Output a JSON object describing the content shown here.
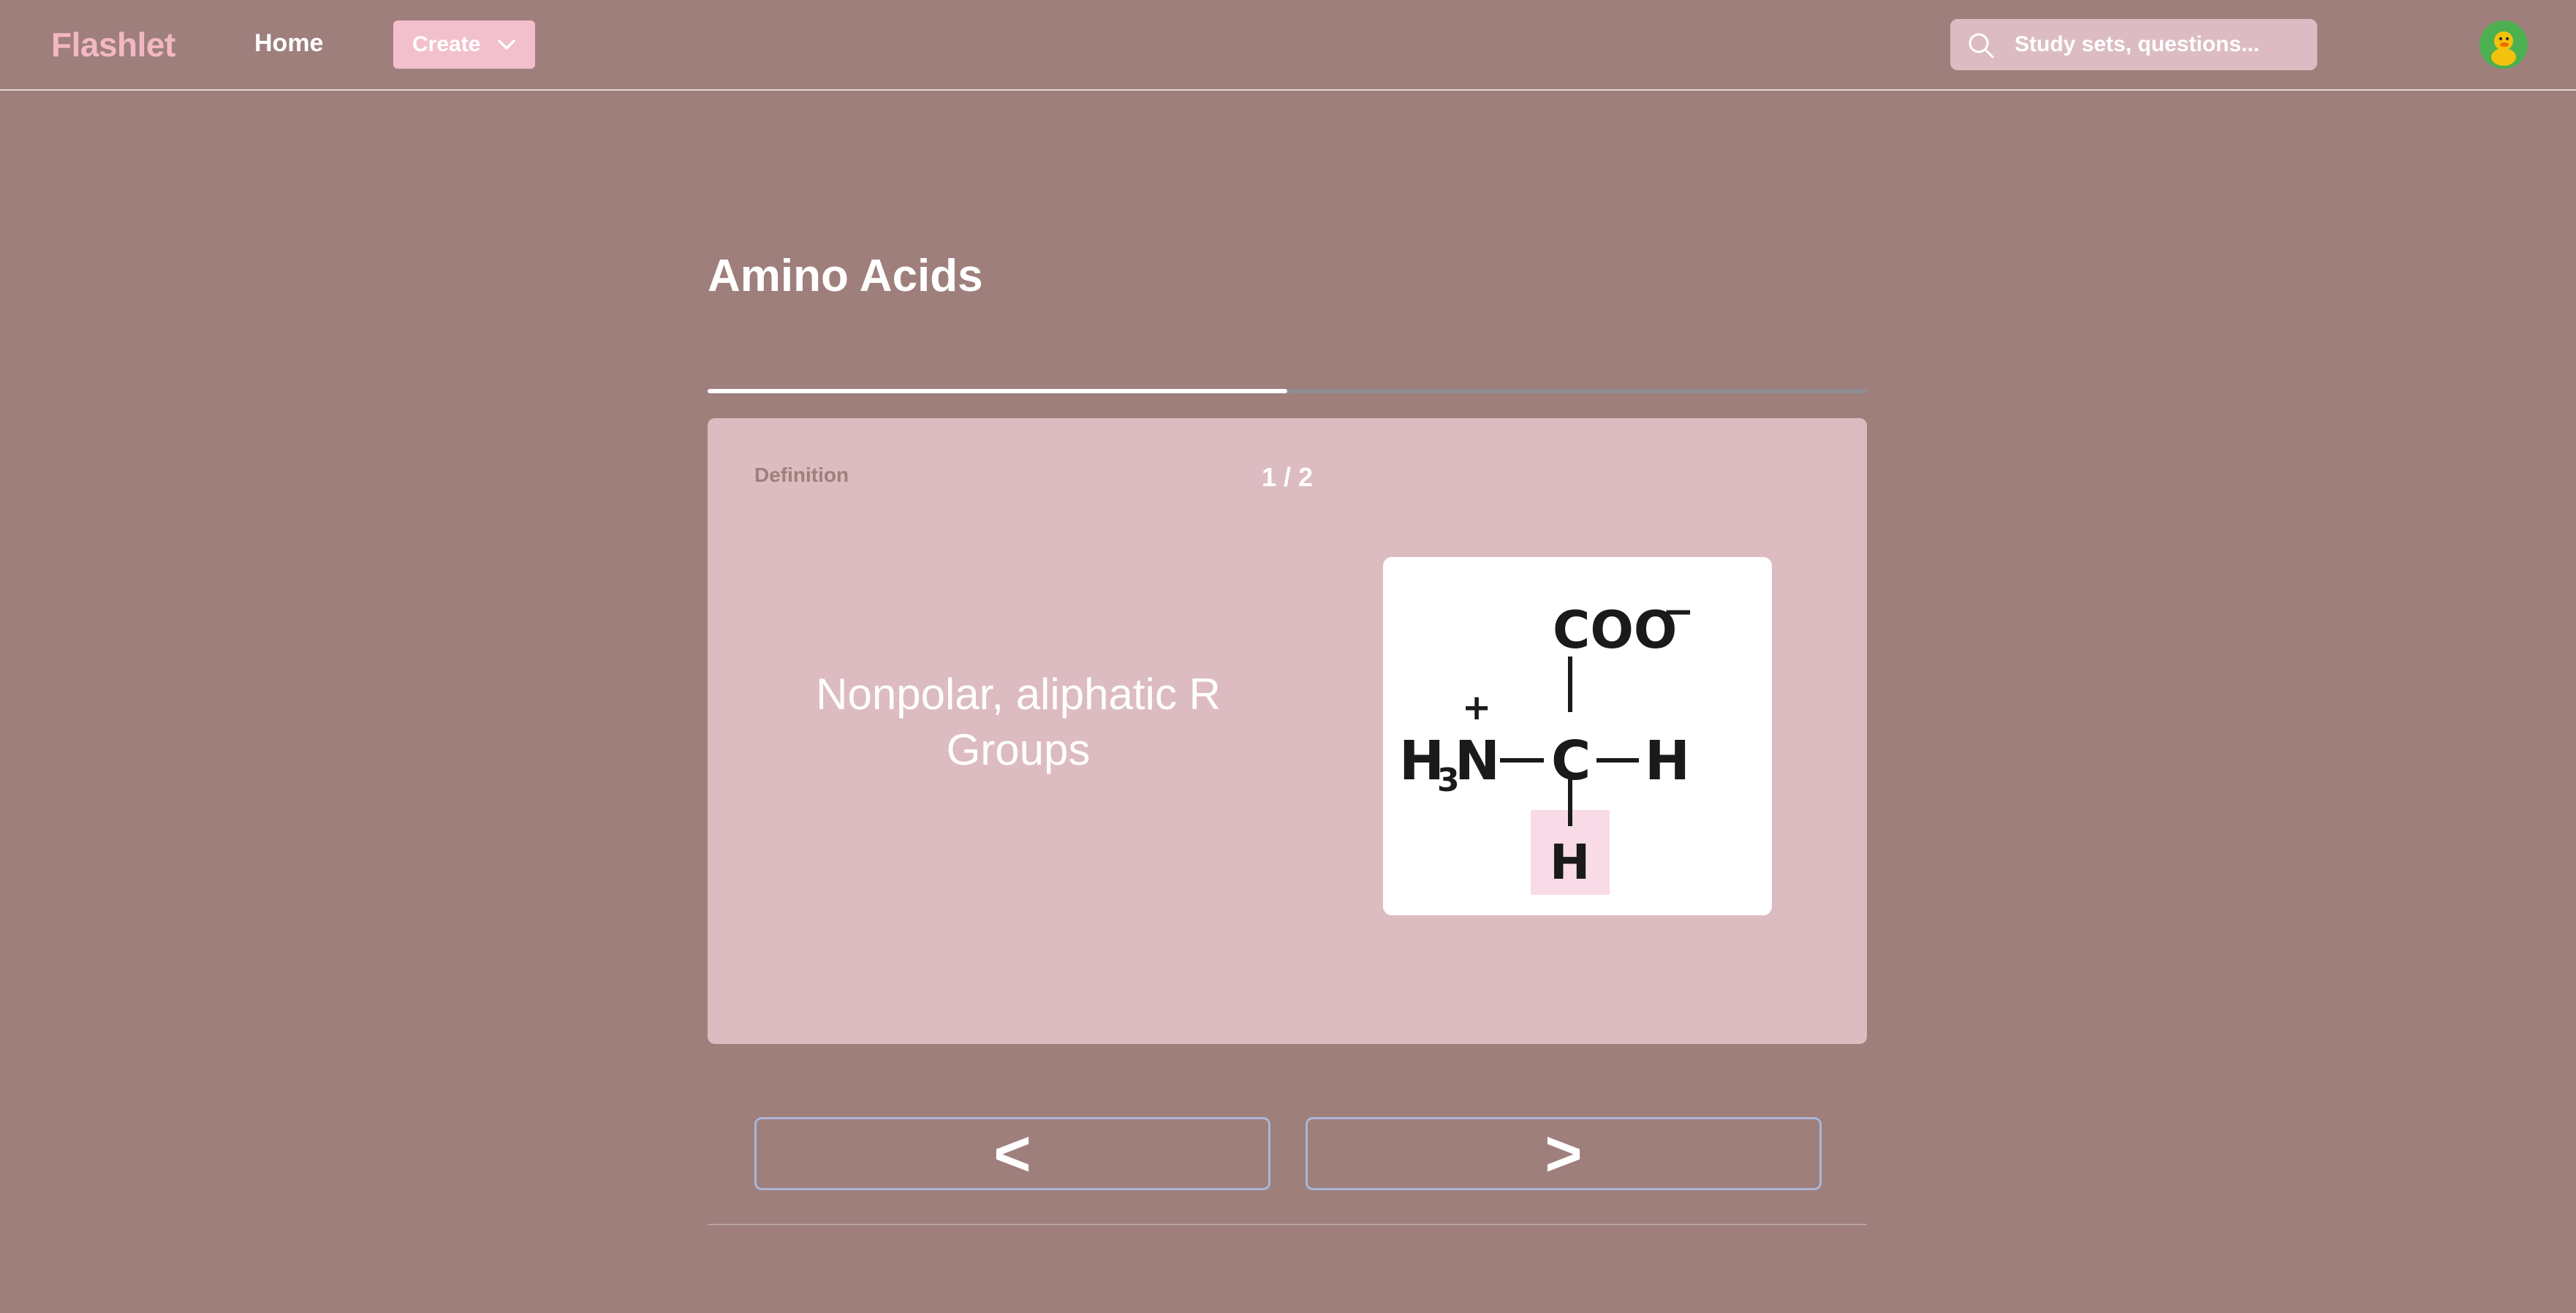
{
  "header": {
    "brand": "Flashlet",
    "nav_home": "Home",
    "create_label": "Create",
    "search_placeholder": "Study sets, questions...",
    "avatar_icon": "duck-avatar-icon"
  },
  "set": {
    "title": "Amino Acids",
    "progress_fraction": 0.5
  },
  "card": {
    "side_label": "Definition",
    "counter": "1 / 2",
    "text": "Nonpolar, aliphatic R Groups",
    "image": {
      "top_group": "COO",
      "top_charge": "−",
      "left_group": "H",
      "left_subscript": "3",
      "left_atom": "N",
      "left_charge": "+",
      "center_atom": "C",
      "right_atom": "H",
      "bottom_atom": "H",
      "highlight_color": "#f9dbe8"
    }
  },
  "navigation": {
    "prev_label": "<",
    "next_label": ">"
  },
  "colors": {
    "background": "#9e7f7c",
    "brand": "#f2b8c4",
    "card": "#dcbcc0"
  }
}
